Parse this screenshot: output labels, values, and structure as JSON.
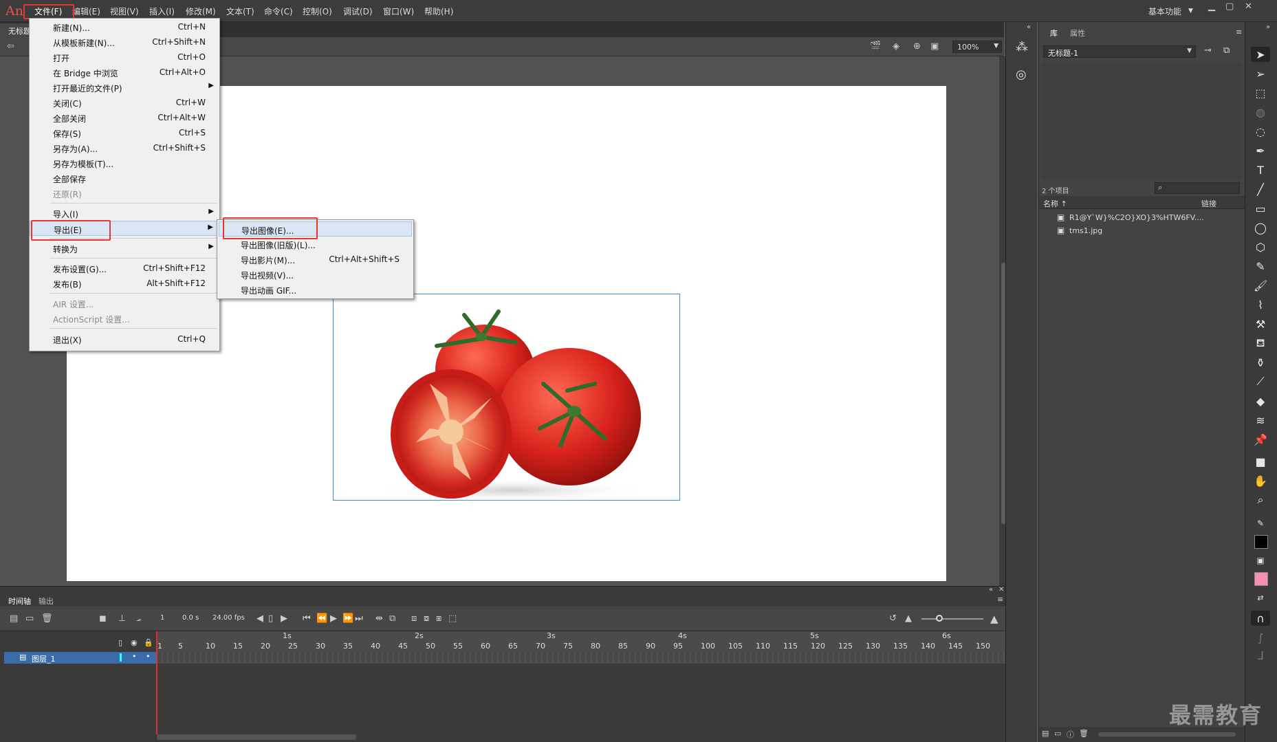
{
  "app": {
    "logo": "An"
  },
  "menubar": {
    "items": [
      "文件(F)",
      "编辑(E)",
      "视图(V)",
      "插入(I)",
      "修改(M)",
      "文本(T)",
      "命令(C)",
      "控制(O)",
      "调试(D)",
      "窗口(W)",
      "帮助(H)"
    ],
    "workspace": "基本功能"
  },
  "doc_tab": "无标题",
  "file_menu": [
    {
      "label": "新建(N)...",
      "shortcut": "Ctrl+N"
    },
    {
      "label": "从模板新建(N)...",
      "shortcut": "Ctrl+Shift+N"
    },
    {
      "label": "打开",
      "shortcut": "Ctrl+O"
    },
    {
      "label": "在 Bridge 中浏览",
      "shortcut": "Ctrl+Alt+O"
    },
    {
      "label": "打开最近的文件(P)",
      "shortcut": ""
    },
    {
      "label": "关闭(C)",
      "shortcut": "Ctrl+W"
    },
    {
      "label": "全部关闭",
      "shortcut": "Ctrl+Alt+W"
    },
    {
      "label": "保存(S)",
      "shortcut": "Ctrl+S"
    },
    {
      "label": "另存为(A)...",
      "shortcut": "Ctrl+Shift+S"
    },
    {
      "label": "另存为模板(T)...",
      "shortcut": ""
    },
    {
      "label": "全部保存",
      "shortcut": ""
    },
    {
      "label": "还原(R)",
      "shortcut": ""
    },
    {
      "label": "导入(I)",
      "shortcut": ""
    },
    {
      "label": "导出(E)",
      "shortcut": ""
    },
    {
      "label": "转换为",
      "shortcut": ""
    },
    {
      "label": "发布设置(G)...",
      "shortcut": "Ctrl+Shift+F12"
    },
    {
      "label": "发布(B)",
      "shortcut": "Alt+Shift+F12"
    },
    {
      "label": "AIR 设置...",
      "shortcut": ""
    },
    {
      "label": "ActionScript 设置...",
      "shortcut": ""
    },
    {
      "label": "退出(X)",
      "shortcut": "Ctrl+Q"
    }
  ],
  "export_menu": [
    {
      "label": "导出图像(E)...",
      "shortcut": ""
    },
    {
      "label": "导出图像(旧版)(L)...",
      "shortcut": ""
    },
    {
      "label": "导出影片(M)...",
      "shortcut": "Ctrl+Alt+Shift+S"
    },
    {
      "label": "导出视频(V)...",
      "shortcut": ""
    },
    {
      "label": "导出动画 GIF...",
      "shortcut": ""
    }
  ],
  "stage_toolbar": {
    "zoom": "100%"
  },
  "library": {
    "tab_library": "库",
    "tab_properties": "属性",
    "document": "无标题-1",
    "count": "2 个项目",
    "col_name": "名称 ↑",
    "col_link": "链接",
    "items": [
      "R1@Y`W}%C2O}XO}3%HTW6FV....",
      "tms1.jpg"
    ]
  },
  "timeline": {
    "tab_timeline": "时间轴",
    "tab_output": "输出",
    "frame": "1",
    "time": "0.0 s",
    "fps": "24.00 fps",
    "layer": "图层_1",
    "seconds": [
      "1s",
      "2s",
      "3s",
      "4s",
      "5s",
      "6s"
    ],
    "ticks": [
      "1",
      "5",
      "10",
      "15",
      "20",
      "25",
      "30",
      "35",
      "40",
      "45",
      "50",
      "55",
      "60",
      "65",
      "70",
      "75",
      "80",
      "85",
      "90",
      "95",
      "100",
      "105",
      "110",
      "115",
      "120",
      "125",
      "130",
      "135",
      "140",
      "145",
      "150"
    ]
  },
  "watermark": "最需教育",
  "colors": {
    "highlight": "#e8352e",
    "selection": "#3a8bd6",
    "stroke": "#000000",
    "fill": "#f48fb1"
  }
}
